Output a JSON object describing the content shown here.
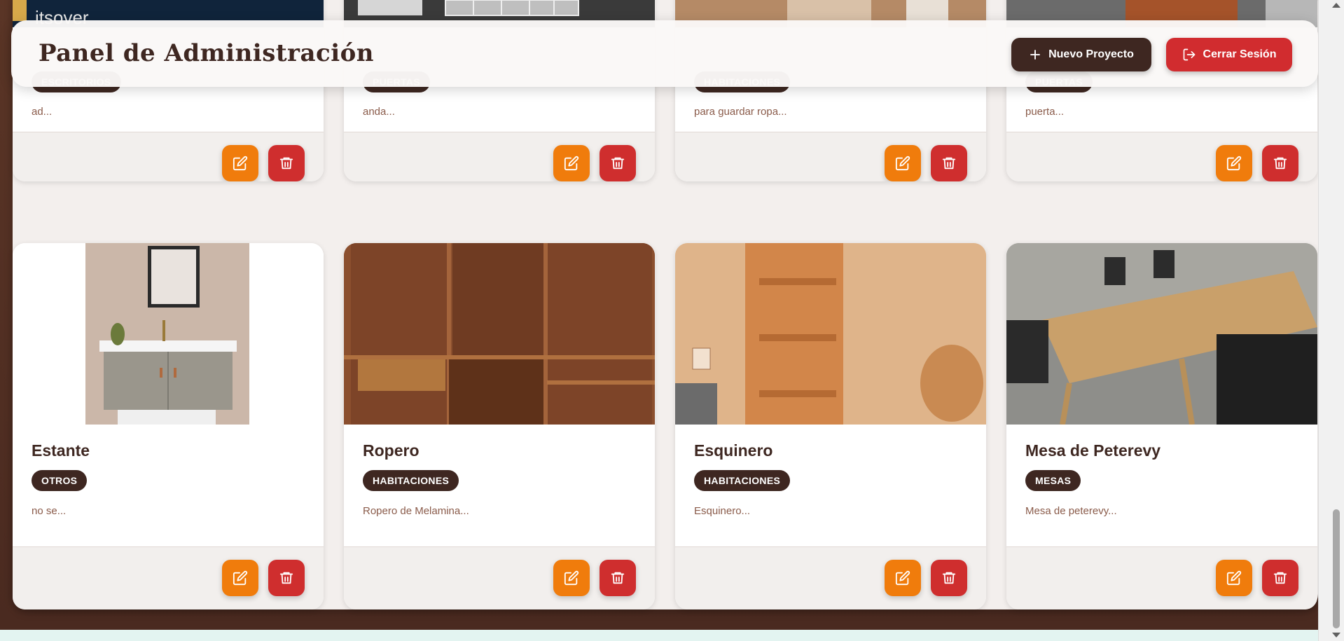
{
  "header": {
    "title": "Panel de Administración",
    "new_project_label": "Nuevo Proyecto",
    "logout_label": "Cerrar Sesión"
  },
  "top_strip": {
    "partial_text": "itsover"
  },
  "cards_row1": [
    {
      "category": "ESCRITORIOS",
      "description": "ad..."
    },
    {
      "category": "PUERTAS",
      "description": "anda..."
    },
    {
      "category": "HABITACIONES",
      "description": "para guardar ropa..."
    },
    {
      "category": "PUERTAS",
      "description": "puerta..."
    }
  ],
  "cards_row2": [
    {
      "title": "Estante",
      "category": "OTROS",
      "description": "no se...",
      "image": "bathroom-vanity"
    },
    {
      "title": "Ropero",
      "category": "HABITACIONES",
      "description": "Ropero de Melamina...",
      "image": "wooden-wardrobe"
    },
    {
      "title": "Esquinero",
      "category": "HABITACIONES",
      "description": "Esquinero...",
      "image": "corner-shelf"
    },
    {
      "title": "Mesa de Peterevy",
      "category": "MESAS",
      "description": "Mesa de peterevy...",
      "image": "dining-table"
    }
  ],
  "colors": {
    "primary_dark": "#3e2721",
    "edit_orange": "#f07c0c",
    "delete_red": "#cf2e2e",
    "logout_red": "#d12c2f"
  },
  "icons": {
    "edit": "edit-icon",
    "delete": "trash-icon",
    "new": "plus-icon",
    "logout": "logout-icon"
  }
}
